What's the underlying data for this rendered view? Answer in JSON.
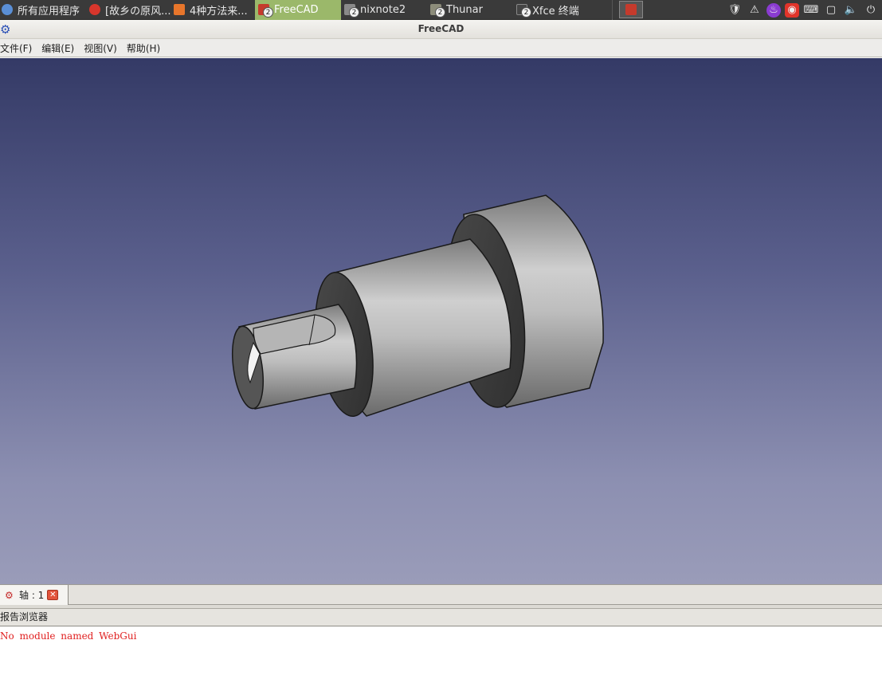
{
  "taskbar": {
    "apps_menu_label": "所有应用程序",
    "items": [
      {
        "label": "[故乡の原风...",
        "icon": "netease-music-icon",
        "badge": ""
      },
      {
        "label": "4种方法来...",
        "icon": "firefox-icon",
        "badge": ""
      },
      {
        "label": "FreeCAD",
        "icon": "freecad-icon",
        "badge": "2",
        "active": true
      },
      {
        "label": "nixnote2",
        "icon": "nixnote-icon",
        "badge": "2"
      },
      {
        "label": "Thunar",
        "icon": "folder-icon",
        "badge": "2"
      },
      {
        "label": "Xfce 终端",
        "icon": "terminal-icon",
        "badge": "2"
      }
    ],
    "tray": [
      "shield-icon",
      "warning-icon",
      "flame-icon",
      "netease-icon",
      "keyboard-icon",
      "window-icon",
      "volume-icon",
      "power-icon"
    ]
  },
  "window": {
    "title": "FreeCAD"
  },
  "menu": {
    "file": "文件(F)",
    "edit": "编辑(E)",
    "view": "视图(V)",
    "help": "帮助(H)"
  },
  "doc_tab": {
    "label": "轴 : 1"
  },
  "report": {
    "title": "报告浏览器",
    "message": "No module named WebGui",
    "message_color": "#e02020"
  },
  "colors": {
    "viewport_top": "#343a66",
    "viewport_bottom": "#9a9cb9",
    "active_task": "#9bb86a"
  }
}
